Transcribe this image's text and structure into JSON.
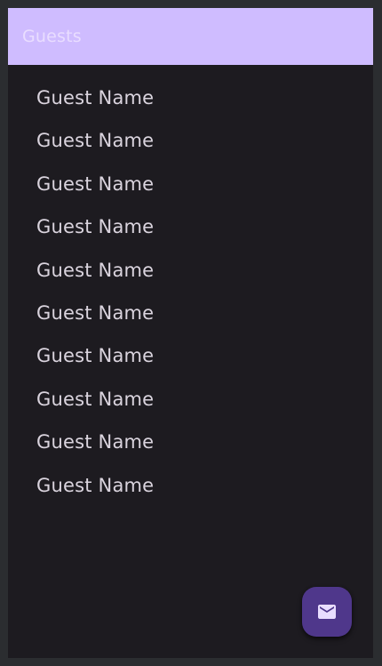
{
  "app_bar": {
    "title": "Guests"
  },
  "guests": [
    {
      "name": "Guest Name"
    },
    {
      "name": "Guest Name"
    },
    {
      "name": "Guest Name"
    },
    {
      "name": "Guest Name"
    },
    {
      "name": "Guest Name"
    },
    {
      "name": "Guest Name"
    },
    {
      "name": "Guest Name"
    },
    {
      "name": "Guest Name"
    },
    {
      "name": "Guest Name"
    },
    {
      "name": "Guest Name"
    }
  ],
  "fab": {
    "icon": "mail-icon"
  },
  "colors": {
    "app_bar_background": "#cfbcff",
    "app_bar_title": "#e9ddff",
    "surface": "#1d1b20",
    "list_text": "#dad4de",
    "fab_background": "#4f378b",
    "fab_icon": "#e9ddff"
  }
}
